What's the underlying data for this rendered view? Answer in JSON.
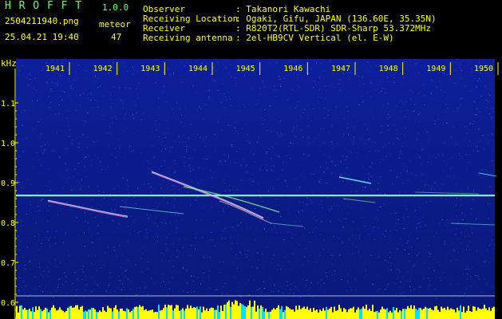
{
  "app": {
    "name": "H R O F F T",
    "version": "1.0.0"
  },
  "file": {
    "name": "2504211940.png",
    "datetime": "25.04.21 19:40"
  },
  "meteor": {
    "label": "meteor",
    "count": "47"
  },
  "info": {
    "observer_label": "Observer",
    "observer_value": ": Takanori Kawachi",
    "location_label": "Receiving Location",
    "location_value": ": Ogaki, Gifu, JAPAN (136.60E, 35.35N)",
    "receiver_label": "Receiver",
    "receiver_value": ": R820T2(RTL-SDR) SDR-Sharp 53.372MHz",
    "antenna_label": "Receiving antenna",
    "antenna_value": ": 2el-HB9CV Vertical (el. E-W)"
  },
  "axis": {
    "y_unit": "kHz",
    "y_ticks": [
      "1.1",
      "1.0",
      "0.9",
      "0.8",
      "0.7",
      "0.6"
    ],
    "y_values": [
      1.1,
      1.0,
      0.9,
      0.8,
      0.7,
      0.6
    ],
    "x_ticks": [
      "1941",
      "1942",
      "1943",
      "1944",
      "1945",
      "1946",
      "1947",
      "1948",
      "1949",
      "1950"
    ]
  },
  "colors": {
    "text": "#ffff00",
    "bg": "#000000",
    "noise": "#0a1a8c",
    "carrier": "#7fffff"
  }
}
